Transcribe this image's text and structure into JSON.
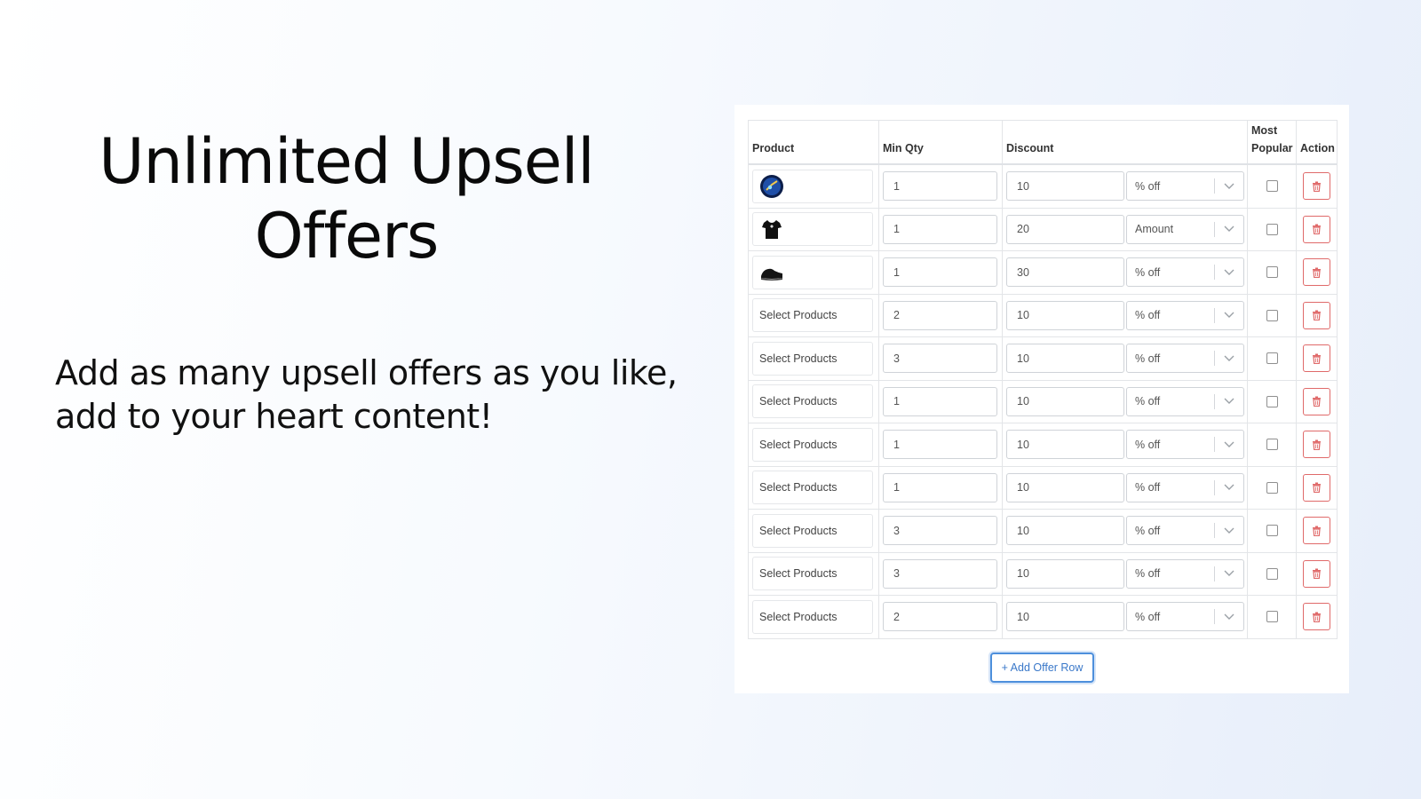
{
  "hero": {
    "title": "Unlimited Upsell Offers",
    "subtitle": "Add as many upsell offers as you like, add to your heart content!"
  },
  "table": {
    "headers": {
      "product": "Product",
      "min_qty": "Min Qty",
      "discount": "Discount",
      "most_popular_line1": "Most",
      "most_popular_line2": "Popular",
      "action": "Action"
    },
    "rows": [
      {
        "product": "",
        "image": "globe-product-image",
        "min_qty": "1",
        "discount": "10",
        "type": "% off"
      },
      {
        "product": "",
        "image": "tshirt-product-image",
        "min_qty": "1",
        "discount": "20",
        "type": "Amount"
      },
      {
        "product": "",
        "image": "shoe-product-image",
        "min_qty": "1",
        "discount": "30",
        "type": "% off"
      },
      {
        "product": "Select Products",
        "image": "",
        "min_qty": "2",
        "discount": "10",
        "type": "% off"
      },
      {
        "product": "Select Products",
        "image": "",
        "min_qty": "3",
        "discount": "10",
        "type": "% off"
      },
      {
        "product": "Select Products",
        "image": "",
        "min_qty": "1",
        "discount": "10",
        "type": "% off"
      },
      {
        "product": "Select Products",
        "image": "",
        "min_qty": "1",
        "discount": "10",
        "type": "% off"
      },
      {
        "product": "Select Products",
        "image": "",
        "min_qty": "1",
        "discount": "10",
        "type": "% off"
      },
      {
        "product": "Select Products",
        "image": "",
        "min_qty": "3",
        "discount": "10",
        "type": "% off"
      },
      {
        "product": "Select Products",
        "image": "",
        "min_qty": "3",
        "discount": "10",
        "type": "% off"
      },
      {
        "product": "Select Products",
        "image": "",
        "min_qty": "2",
        "discount": "10",
        "type": "% off"
      }
    ]
  },
  "add_button": {
    "label": "+ Add Offer Row"
  },
  "icons": {
    "caret": "chevron-down-icon",
    "delete": "trash-icon"
  },
  "colors": {
    "accent": "#3a78c9",
    "danger": "#e06a6a"
  }
}
